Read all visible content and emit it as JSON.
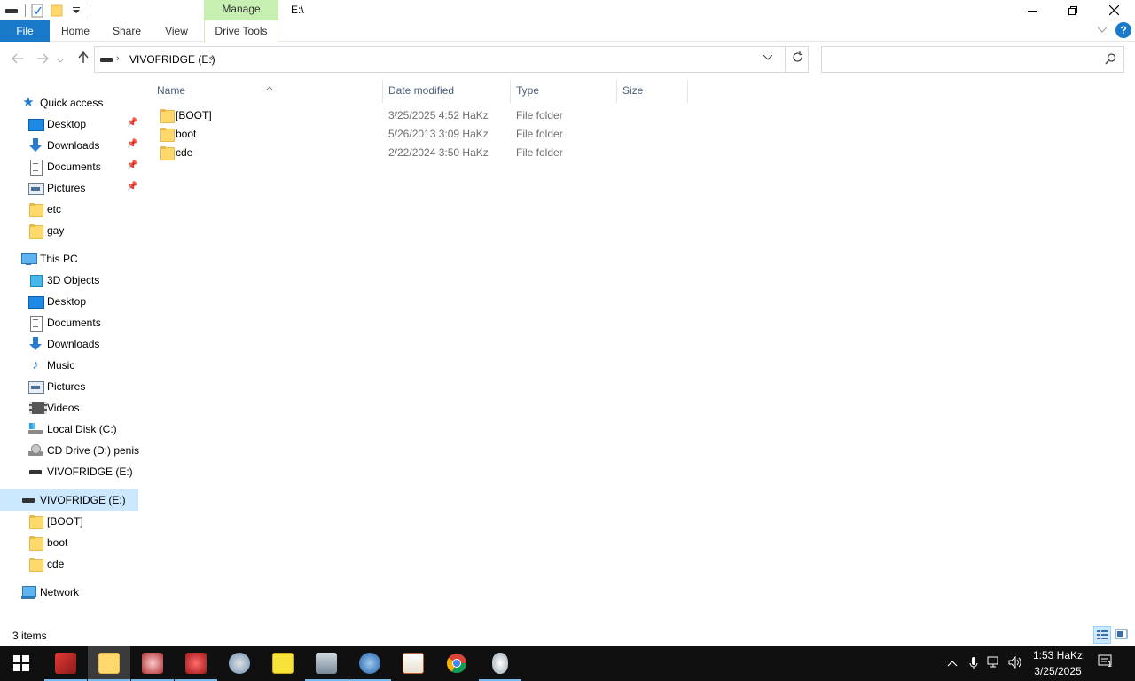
{
  "window": {
    "title": "E:\\",
    "context_tab_group": "Manage",
    "colors": {
      "file_tab": "#1979ca",
      "manage_tab": "#c6efb1",
      "selection": "#cce8ff"
    }
  },
  "ribbon": {
    "tabs": [
      "File",
      "Home",
      "Share",
      "View",
      "Drive Tools"
    ],
    "help_label": "?"
  },
  "address": {
    "crumb": "VIVOFRIDGE (E:)",
    "search_placeholder": ""
  },
  "navigation": {
    "quick_access": {
      "label": "Quick access",
      "items": [
        {
          "label": "Desktop",
          "icon": "desktop-icon",
          "pinned": true
        },
        {
          "label": "Downloads",
          "icon": "downloads-icon",
          "pinned": true
        },
        {
          "label": "Documents",
          "icon": "documents-icon",
          "pinned": true
        },
        {
          "label": "Pictures",
          "icon": "pictures-icon",
          "pinned": true
        },
        {
          "label": "etc",
          "icon": "folder-icon",
          "pinned": false
        },
        {
          "label": "gay",
          "icon": "folder-icon",
          "pinned": false
        }
      ]
    },
    "this_pc": {
      "label": "This PC",
      "items": [
        {
          "label": "3D Objects",
          "icon": "3d-objects-icon"
        },
        {
          "label": "Desktop",
          "icon": "desktop-icon"
        },
        {
          "label": "Documents",
          "icon": "documents-icon"
        },
        {
          "label": "Downloads",
          "icon": "downloads-icon"
        },
        {
          "label": "Music",
          "icon": "music-icon"
        },
        {
          "label": "Pictures",
          "icon": "pictures-icon"
        },
        {
          "label": "Videos",
          "icon": "videos-icon"
        },
        {
          "label": "Local Disk (C:)",
          "icon": "local-disk-icon"
        },
        {
          "label": "CD Drive (D:) penis",
          "icon": "cd-drive-icon"
        },
        {
          "label": "VIVOFRIDGE (E:)",
          "icon": "usb-drive-icon"
        }
      ]
    },
    "drive": {
      "label": "VIVOFRIDGE (E:)",
      "selected": true,
      "items": [
        {
          "label": "[BOOT]",
          "icon": "folder-icon"
        },
        {
          "label": "boot",
          "icon": "folder-icon"
        },
        {
          "label": "cde",
          "icon": "folder-icon"
        }
      ]
    },
    "network": {
      "label": "Network"
    }
  },
  "file_list": {
    "columns": [
      "Name",
      "Date modified",
      "Type",
      "Size"
    ],
    "rows": [
      {
        "name": "[BOOT]",
        "date": "3/25/2025 4:52 HaKz",
        "type": "File folder",
        "size": ""
      },
      {
        "name": "boot",
        "date": "5/26/2013 3:09 HaKz",
        "type": "File folder",
        "size": ""
      },
      {
        "name": "cde",
        "date": "2/22/2024 3:50 HaKz",
        "type": "File folder",
        "size": ""
      }
    ]
  },
  "status": {
    "item_count": "3 items"
  },
  "taskbar": {
    "apps": [
      {
        "icon": "start-icon",
        "active": false
      },
      {
        "icon": "app-red-cube-icon",
        "active": false
      },
      {
        "icon": "file-explorer-icon",
        "active": true
      },
      {
        "icon": "app-characters-icon",
        "active": false
      },
      {
        "icon": "app-red-figure-icon",
        "active": false
      },
      {
        "icon": "paint-palette-icon",
        "active": false
      },
      {
        "icon": "spongebob-icon",
        "active": false
      },
      {
        "icon": "image-viewer-icon",
        "active": false
      },
      {
        "icon": "globe-app-icon",
        "active": false
      },
      {
        "icon": "java-icon",
        "active": false
      },
      {
        "icon": "chrome-icon",
        "active": false
      },
      {
        "icon": "egg-app-icon",
        "active": false
      }
    ],
    "clock_time": "1:53 HaKz",
    "clock_date": "3/25/2025",
    "notification_count": "1"
  }
}
